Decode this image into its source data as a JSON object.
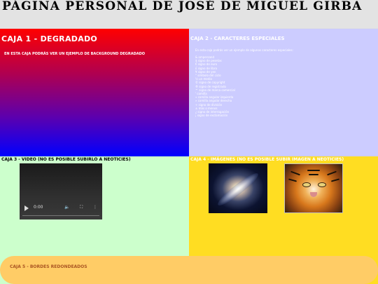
{
  "page": {
    "title": "PÁGINA PERSONAL DE JOSÉ DE MIGUEL GIRBA"
  },
  "box1": {
    "title": "CAJA 1 - DEGRADADO",
    "text": "EN ESTA CAJA PODRÁS VER UN EJEMPLO DE BACKGROUND DEGRADADO"
  },
  "box2": {
    "title": "CAJA 2 - CARACTERES ESPECIALES",
    "intro": "En esta caja podrás ver un ejemplo de algunos caracteres especiales:",
    "items": [
      "& ampersand",
      "$ signo de pesetas",
      "€ signo de euro",
      "£ signo de libra",
      "¥ signo de yen",
      "° símbolo del ciclo",
      "½ un medio",
      "© signo de copyright",
      "® signo de registrado",
      "™ signo de marca comercial",
      "' comilla",
      "« comilla angular izquierda",
      "» comilla angular derecha",
      "÷ signo de división",
      "± más o menos",
      "¿ signo de interrogación",
      "¡ signo de exclamación"
    ]
  },
  "box3": {
    "title": "CAJA 3 - VIDEO (NO ES POSIBLE SUBIRLO A NEOTICIES)",
    "video_time": "0:00"
  },
  "box4": {
    "title": "CAJA 4 - IMÁGENES (NO ES POSIBLE SUBIR IMAGEN A NEOTICIES)"
  },
  "box5": {
    "title": "CAJA 5 - BORDES REDONDEADOS"
  },
  "colors": {
    "box1_gradient": [
      "#ff0000",
      "#0000ff"
    ],
    "box2_bg": "#ccccff",
    "box3_bg": "#ccffcc",
    "box4_bg": "#ffdd22",
    "box5_bg": "#ffcc66"
  },
  "icons": {
    "video_play": "play-icon",
    "video_volume": "volume-icon",
    "video_fullscreen": "fullscreen-icon",
    "video_more": "more-options-icon"
  }
}
